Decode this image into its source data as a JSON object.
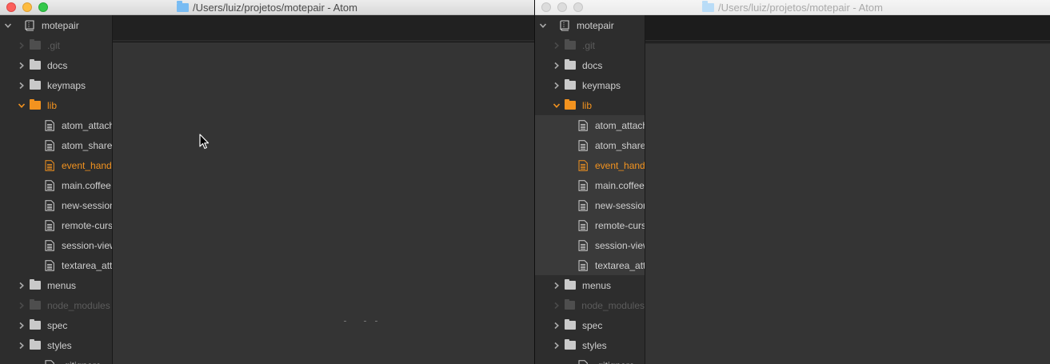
{
  "windows": {
    "left": {
      "title": "/Users/luiz/projetos/motepair - Atom",
      "focused": true
    },
    "right": {
      "title": "/Users/luiz/projetos/motepair - Atom",
      "focused": false
    }
  },
  "tree": {
    "root": "motepair",
    "items": [
      {
        "type": "dir",
        "label": ".git",
        "state": "ignored",
        "icon": "chevron-right-icon"
      },
      {
        "type": "dir",
        "label": "docs",
        "state": "normal",
        "icon": "chevron-right-icon"
      },
      {
        "type": "dir",
        "label": "keymaps",
        "state": "normal",
        "icon": "chevron-right-icon"
      },
      {
        "type": "dir",
        "label": "lib",
        "state": "selected",
        "icon": "chevron-down-icon"
      },
      {
        "type": "file",
        "label": "atom_attach_view.coffee",
        "state": "normal"
      },
      {
        "type": "file",
        "label": "atom_share_view.coffee",
        "state": "normal"
      },
      {
        "type": "file",
        "label": "event_handler.coffee",
        "state": "selected"
      },
      {
        "type": "file",
        "label": "main.coffee",
        "state": "normal"
      },
      {
        "type": "file",
        "label": "new-session-view.coffee",
        "state": "normal"
      },
      {
        "type": "file",
        "label": "remote-cursor-view.coffee",
        "state": "normal"
      },
      {
        "type": "file",
        "label": "session-view.coffee",
        "state": "normal"
      },
      {
        "type": "file",
        "label": "textarea_attach.coffee",
        "state": "normal"
      },
      {
        "type": "dir",
        "label": "menus",
        "state": "normal",
        "icon": "chevron-right-icon"
      },
      {
        "type": "dir",
        "label": "node_modules",
        "state": "ignored",
        "icon": "chevron-right-icon"
      },
      {
        "type": "dir",
        "label": "spec",
        "state": "normal",
        "icon": "chevron-right-icon"
      },
      {
        "type": "dir",
        "label": "styles",
        "state": "normal",
        "icon": "chevron-right-icon"
      },
      {
        "type": "file",
        "label": ".gitignore",
        "state": "normal"
      }
    ]
  },
  "colors": {
    "accent": "#f3931f",
    "ignored": "#5c5c5c",
    "text": "#cfcfcf",
    "folder_title": "#79bcf3"
  }
}
